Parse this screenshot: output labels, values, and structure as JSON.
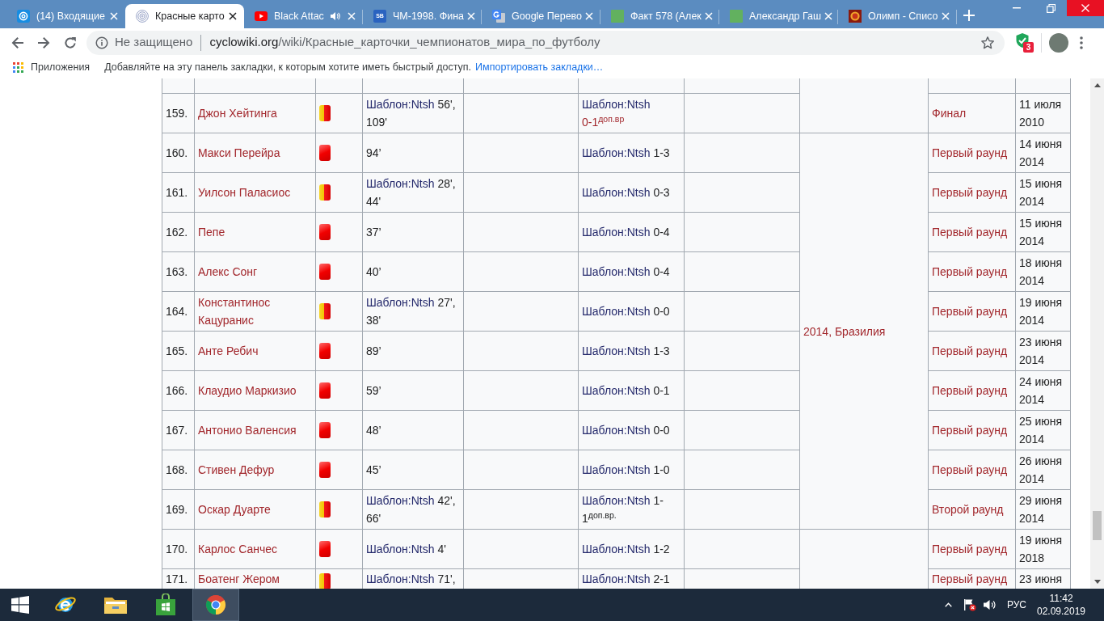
{
  "browser": {
    "tabs": [
      {
        "title": "(14) Входящие",
        "favicon": {
          "kind": "mail"
        },
        "audio": false,
        "selected": false
      },
      {
        "title": "Красные карто",
        "favicon": {
          "kind": "spiral"
        },
        "audio": false,
        "selected": true
      },
      {
        "title": "Black Attac",
        "favicon": {
          "kind": "video"
        },
        "audio": true,
        "selected": false
      },
      {
        "title": "ЧМ-1998. Фина",
        "favicon": {
          "kind": "letters",
          "text": "SB"
        },
        "audio": false,
        "selected": false
      },
      {
        "title": "Google Перево",
        "favicon": {
          "kind": "translate"
        },
        "audio": false,
        "selected": false
      },
      {
        "title": "Факт 578 (Алек",
        "favicon": {
          "kind": "square"
        },
        "audio": false,
        "selected": false
      },
      {
        "title": "Александр Гаш",
        "favicon": {
          "kind": "square"
        },
        "audio": false,
        "selected": false
      },
      {
        "title": "Олимп - Списо",
        "favicon": {
          "kind": "emblem"
        },
        "audio": false,
        "selected": false
      }
    ],
    "address_bar": {
      "security": "Не защищено",
      "domain": "cyclowiki.org",
      "path": "/wiki/Красные_карточки_чемпионатов_мира_по_футболу"
    },
    "extension_count": "3",
    "bookmarks_bar": {
      "apps": "Приложения",
      "hint": "Добавляйте на эту панель закладки, к которым хотите иметь быстрый доступ.",
      "import_link": "Импортировать закладки…"
    }
  },
  "table": {
    "groups": [
      {
        "rows": [
          {
            "number": "159.",
            "name": "Джон Хейтинга",
            "card": {
              "kind": "second_yellow"
            },
            "minutes": {
              "template": "Шаблон:Ntsh",
              "text": "56', 109'"
            },
            "score": {
              "template": "Шаблон:Ntsh",
              "text": "0-1$^{доп.вр}$",
              "linked": true
            },
            "stage": "Финал",
            "date": "11 июля 2010"
          }
        ]
      },
      {
        "tournament": "2014, Бразилия",
        "rows": [
          {
            "number": "160.",
            "name": "Макси Перейра",
            "card": {
              "kind": "red"
            },
            "minutes": {
              "text": "94’"
            },
            "score": {
              "template": "Шаблон:Ntsh",
              "text": "1-3",
              "linked": false
            },
            "stage": "Первый раунд",
            "date": "14 июня 2014"
          },
          {
            "number": "161.",
            "name": "Уилсон Паласиос",
            "card": {
              "kind": "second_yellow"
            },
            "minutes": {
              "template": "Шаблон:Ntsh",
              "text": "28', 44'"
            },
            "score": {
              "template": "Шаблон:Ntsh",
              "text": "0-3",
              "linked": false
            },
            "stage": "Первый раунд",
            "date": "15 июня 2014"
          },
          {
            "number": "162.",
            "name": "Пепе",
            "card": {
              "kind": "red"
            },
            "minutes": {
              "text": "37’"
            },
            "score": {
              "template": "Шаблон:Ntsh",
              "text": "0-4",
              "linked": false
            },
            "stage": "Первый раунд",
            "date": "15 июня 2014"
          },
          {
            "number": "163.",
            "name": "Алекс Сонг",
            "card": {
              "kind": "red"
            },
            "minutes": {
              "text": "40’"
            },
            "score": {
              "template": "Шаблон:Ntsh",
              "text": "0-4",
              "linked": false
            },
            "stage": "Первый раунд",
            "date": "18 июня 2014"
          },
          {
            "number": "164.",
            "name": "Константинос Кацуранис",
            "card": {
              "kind": "second_yellow"
            },
            "minutes": {
              "template": "Шаблон:Ntsh",
              "text": "27', 38'"
            },
            "score": {
              "template": "Шаблон:Ntsh",
              "text": "0-0",
              "linked": false
            },
            "stage": "Первый раунд",
            "date": "19 июня 2014"
          },
          {
            "number": "165.",
            "name": "Анте Ребич",
            "card": {
              "kind": "red"
            },
            "minutes": {
              "text": "89’"
            },
            "score": {
              "template": "Шаблон:Ntsh",
              "text": "1-3",
              "linked": false
            },
            "stage": "Первый раунд",
            "date": "23 июня 2014"
          },
          {
            "number": "166.",
            "name": "Клаудио Маркизио",
            "card": {
              "kind": "red"
            },
            "minutes": {
              "text": "59’"
            },
            "score": {
              "template": "Шаблон:Ntsh",
              "text": "0-1",
              "linked": false
            },
            "stage": "Первый раунд",
            "date": "24 июня 2014"
          },
          {
            "number": "167.",
            "name": "Антонио Валенсия",
            "card": {
              "kind": "red"
            },
            "minutes": {
              "text": "48’"
            },
            "score": {
              "template": "Шаблон:Ntsh",
              "text": "0-0",
              "linked": false
            },
            "stage": "Первый раунд",
            "date": "25 июня 2014"
          },
          {
            "number": "168.",
            "name": "Стивен Дефур",
            "card": {
              "kind": "red"
            },
            "minutes": {
              "text": "45’"
            },
            "score": {
              "template": "Шаблон:Ntsh",
              "text": "1-0",
              "linked": false
            },
            "stage": "Первый раунд",
            "date": "26 июня 2014"
          },
          {
            "number": "169.",
            "name": "Оскар Дуарте",
            "card": {
              "kind": "second_yellow"
            },
            "minutes": {
              "template": "Шаблон:Ntsh",
              "text": "42', 66'"
            },
            "score": {
              "template": "Шаблон:Ntsh",
              "text": "1-1$^{доп.вр.}$",
              "linked": false
            },
            "stage": "Второй раунд",
            "date": "29 июня 2014"
          }
        ]
      },
      {
        "rows": [
          {
            "number": "170.",
            "name": "Карлос Санчес",
            "card": {
              "kind": "red"
            },
            "minutes": {
              "template": "Шаблон:Ntsh",
              "text": "4'"
            },
            "score": {
              "template": "Шаблон:Ntsh",
              "text": "1-2",
              "linked": false
            },
            "stage": "Первый раунд",
            "date": "19 июня 2018"
          },
          {
            "number": "171.",
            "name": "Боатенг Жером",
            "card": {
              "kind": "second_yellow"
            },
            "minutes": {
              "template": "Шаблон:Ntsh",
              "text": "71',"
            },
            "score": {
              "template": "Шаблон:Ntsh",
              "text": "2-1",
              "linked": false
            },
            "stage": "Первый раунд",
            "date": "23 июня"
          }
        ]
      }
    ]
  },
  "taskbar": {
    "apps": [
      {
        "kind": "web_browser",
        "selected": false
      },
      {
        "kind": "folder",
        "selected": false
      },
      {
        "kind": "store",
        "selected": false
      },
      {
        "kind": "chrome",
        "selected": true
      }
    ],
    "language": "РУС",
    "time": "11:42",
    "date": "02.09.2019"
  }
}
